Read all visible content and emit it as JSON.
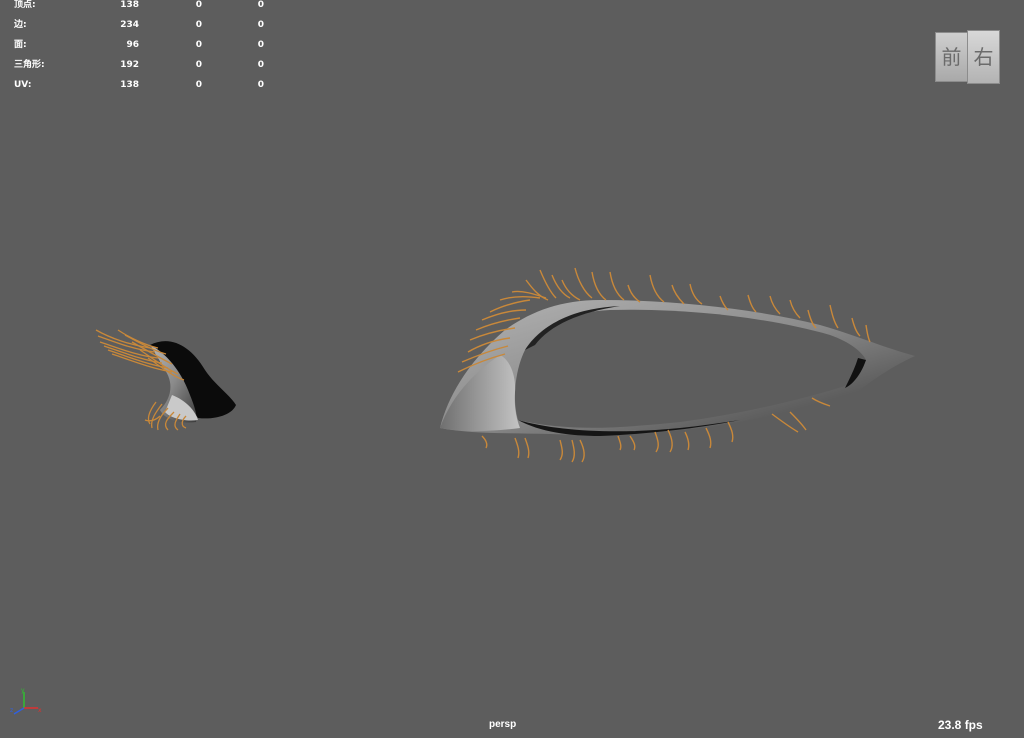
{
  "hud": {
    "rows": [
      {
        "label": "顶点:",
        "c1": "138",
        "c2": "0",
        "c3": "0"
      },
      {
        "label": "边:",
        "c1": "234",
        "c2": "0",
        "c3": "0"
      },
      {
        "label": "面:",
        "c1": "96",
        "c2": "0",
        "c3": "0"
      },
      {
        "label": "三角形:",
        "c1": "192",
        "c2": "0",
        "c3": "0"
      },
      {
        "label": "UV:",
        "c1": "138",
        "c2": "0",
        "c3": "0"
      }
    ]
  },
  "viewcube": {
    "front_label": "前",
    "right_label": "右"
  },
  "camera": "persp",
  "fps": "23.8 fps",
  "axis": {
    "x_color": "#e03030",
    "y_color": "#30c030",
    "z_color": "#3060e0"
  },
  "colors": {
    "background": "#5d5d5d",
    "lash": "#c8883a",
    "lid": "#9a9a9a"
  }
}
